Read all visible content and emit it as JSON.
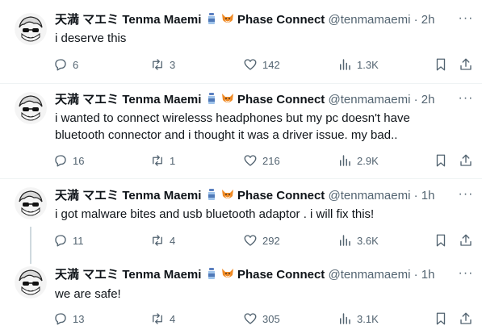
{
  "author": {
    "name": "天満 マエミ Tenma Maemi",
    "org": "Phase Connect",
    "handle": "@tenmamaemi"
  },
  "separator": "·",
  "icons": {
    "reply": "reply-icon",
    "retweet": "retweet-icon",
    "like": "heart-icon",
    "views": "views-icon",
    "bookmark": "bookmark-icon",
    "share": "share-icon"
  },
  "tweets": [
    {
      "time": "2h",
      "text_lines": [
        "i deserve this"
      ],
      "replies": "6",
      "retweets": "3",
      "likes": "142",
      "views": "1.3K"
    },
    {
      "time": "2h",
      "text_lines": [
        "i wanted to connect wirelesss headphones but my pc doesn't have",
        "bluetooth connector and i thought it was a driver issue. my bad.."
      ],
      "replies": "16",
      "retweets": "1",
      "likes": "216",
      "views": "2.9K"
    },
    {
      "time": "1h",
      "text_lines": [
        "i got malware bites and usb bluetooth adaptor . i will fix this!"
      ],
      "replies": "11",
      "retweets": "4",
      "likes": "292",
      "views": "3.6K"
    },
    {
      "time": "1h",
      "text_lines": [
        "we are safe!"
      ],
      "replies": "13",
      "retweets": "4",
      "likes": "305",
      "views": "3.1K"
    }
  ]
}
